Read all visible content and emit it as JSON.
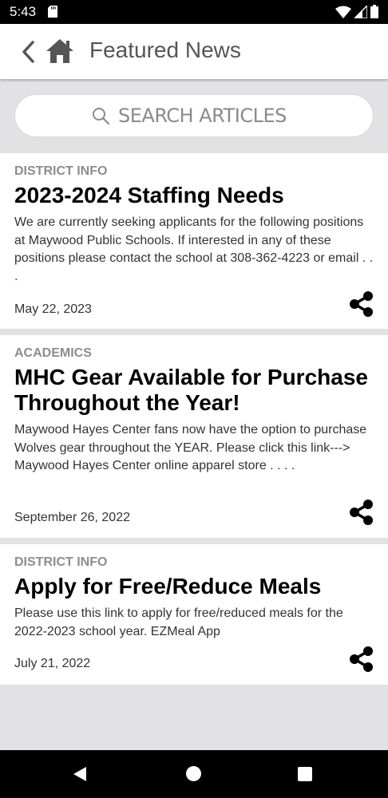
{
  "status_bar": {
    "time": "5:43"
  },
  "header": {
    "title": "Featured News"
  },
  "search": {
    "placeholder": "SEARCH ARTICLES"
  },
  "articles": [
    {
      "category": "DISTRICT INFO",
      "title": "2023-2024 Staffing Needs",
      "excerpt": "We are currently seeking applicants for the following positions at Maywood Public Schools.  If interested in any of these positions please contact the school at 308-362-4223 or email . . .",
      "date": "May 22, 2023"
    },
    {
      "category": "ACADEMICS",
      "title": "MHC Gear Available for Purchase Throughout the Year!",
      "excerpt": "Maywood Hayes Center fans now have the option to purchase Wolves gear throughout the YEAR.  Please click this link--->  Maywood Hayes Center online apparel store . . . .",
      "date": "September 26, 2022"
    },
    {
      "category": "DISTRICT INFO",
      "title": "Apply for Free/Reduce Meals",
      "excerpt": "Please use this link to apply for free/reduced meals for the 2022-2023 school year.   EZMeal App",
      "date": "July 21, 2022"
    }
  ],
  "icons": {
    "back": "chevron-left-icon",
    "home": "home-icon",
    "search": "search-icon",
    "share": "share-icon"
  },
  "colors": {
    "background": "#e2e2e4",
    "card": "#ffffff",
    "category": "#8d8d8d",
    "title_text": "#555555"
  }
}
